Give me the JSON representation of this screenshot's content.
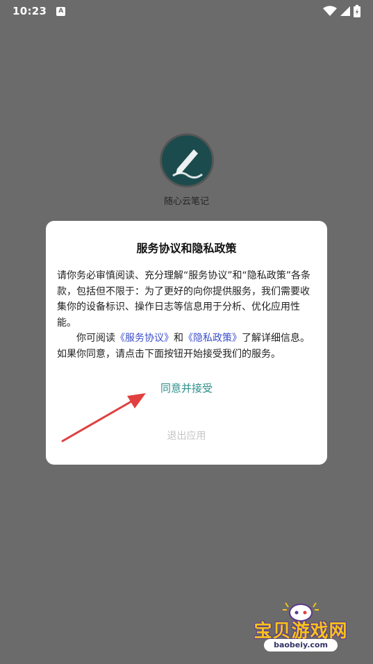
{
  "status_bar": {
    "time": "10:23",
    "notification_icon": "a-icon",
    "icons": [
      "wifi-icon",
      "signal-icon",
      "battery-charging-icon"
    ]
  },
  "app": {
    "name": "随心云笔记",
    "logo_icon": "pen-icon",
    "logo_color": "#1c4b4d"
  },
  "dialog": {
    "title": "服务协议和隐私政策",
    "para1": "请你务必审慎阅读、充分理解“服务协议”和“隐私政策”各条款，包括但不限于：为了更好的向你提供服务，我们需要收集你的设备标识、操作日志等信息用于分析、优化应用性能。",
    "para2_prefix": "你可阅读",
    "link_service": "《服务协议》",
    "para2_and": "和",
    "link_privacy": "《隐私政策》",
    "para2_suffix": "了解详细信息。如果你同意，请点击下面按钮开始接受我们的服务。",
    "accept_label": "同意并接受",
    "exit_label": "退出应用",
    "accept_color": "#2e8f8a",
    "link_color": "#3b4ec9"
  },
  "annotation": {
    "arrow_color": "#e0403f"
  },
  "watermark": {
    "text": "宝贝游戏网",
    "url": "baobeiy.com"
  }
}
